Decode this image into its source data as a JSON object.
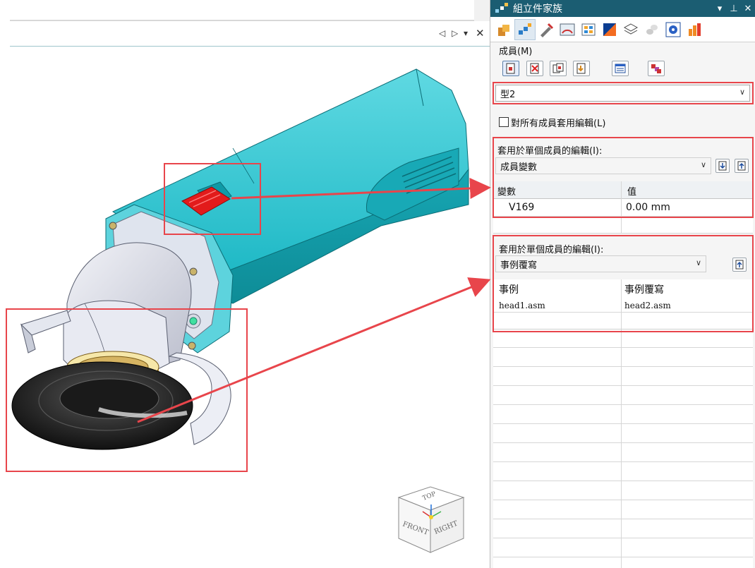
{
  "panel": {
    "title": "組立件家族",
    "controls": {
      "dropdown": "▾",
      "pin": "⊥",
      "close": "✕"
    },
    "tool_tabs": [
      "part-family-icon",
      "assembly-family-icon",
      "tools-icon",
      "gauge-icon",
      "grid-icon",
      "color-icon",
      "layers-icon",
      "cylinders-icon",
      "gear-icon",
      "bar-chart-icon"
    ],
    "members_label": "成員(M)",
    "member_buttons": [
      "add-member-icon",
      "delete-member-icon",
      "copy-member-icon",
      "import-member-icon",
      "table-icon",
      "update-members-icon"
    ],
    "member_value": "型2",
    "apply_all_label": "對所有成員套用編輯(L)",
    "apply_all_checked": false,
    "section1": {
      "label": "套用於單個成員的編輯(I):",
      "selected": "成員變數",
      "headers": [
        "變數",
        "值"
      ],
      "rows": [
        [
          "V169",
          "0.00 mm"
        ]
      ]
    },
    "section2": {
      "label": "套用於單個成員的編輯(I):",
      "selected": "事例覆寫",
      "headers": [
        "事例",
        "事例覆寫"
      ],
      "rows": [
        [
          "head1.asm",
          "head2.asm"
        ]
      ]
    }
  },
  "viewport": {
    "tab_controls": [
      "◁",
      "▷",
      "▾",
      "✕"
    ],
    "viewcube": {
      "top": "TOP",
      "front": "FRONT",
      "right": "RIGHT"
    }
  },
  "colors": {
    "accent": "#1b5d72",
    "highlight": "#e8454b",
    "body": "#1fb9c6",
    "switch": "#e21b1b"
  }
}
